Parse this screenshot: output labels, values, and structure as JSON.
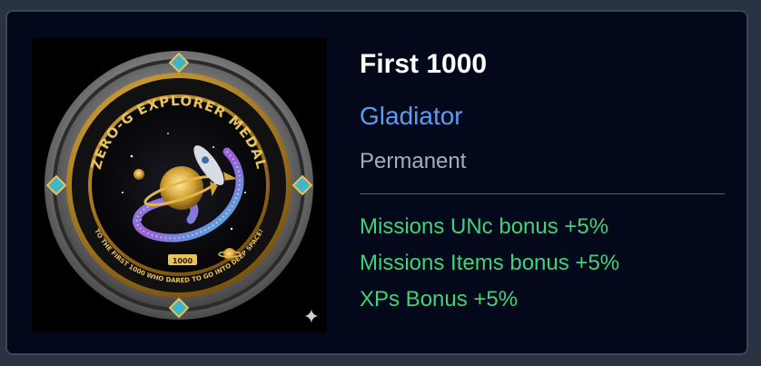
{
  "card": {
    "title": "First 1000",
    "subtitle": "Gladiator",
    "duration": "Permanent",
    "bonuses": [
      "Missions UNc bonus +5%",
      "Missions Items bonus +5%",
      "XPs Bonus +5%"
    ]
  },
  "medal": {
    "ring_text_top": "ZERO-G EXPLORER MEDAL",
    "ring_text_bottom": "TO THE FIRST 1000 WHO DARED TO GO INTO DEEP SPACE!",
    "plaque": "1000",
    "icon": "sparkle-icon"
  },
  "colors": {
    "background": "#03091a",
    "title": "#ffffff",
    "subtitle": "#5b9cf5",
    "duration": "#a6adb8",
    "bonus": "#3ed37a"
  }
}
